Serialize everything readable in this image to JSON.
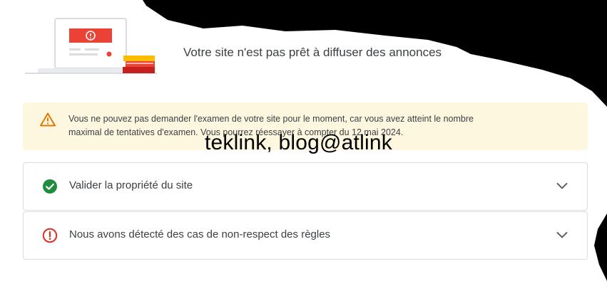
{
  "header": {
    "title": "Votre site n'est pas prêt à diffuser des annonces"
  },
  "alert": {
    "icon": "warning-triangle-icon",
    "line1": "Vous ne pouvez pas demander l'examen de votre site pour le moment, car vous avez atteint le nombre",
    "line2": "maximal de tentatives d'examen. Vous pourrez réessayer à compter du 12 mai 2024.",
    "background": "#fef7e0",
    "icon_color": "#e37400"
  },
  "checks": [
    {
      "label": "Valider la propriété du site",
      "status": "success",
      "icon": "check-circle-icon",
      "color": "#1e8e3e"
    },
    {
      "label": "Nous avons détecté des cas de non-respect des règles",
      "status": "error",
      "icon": "error-circle-icon",
      "color": "#d93025"
    }
  ],
  "watermark": "teklink, blog@atlink"
}
